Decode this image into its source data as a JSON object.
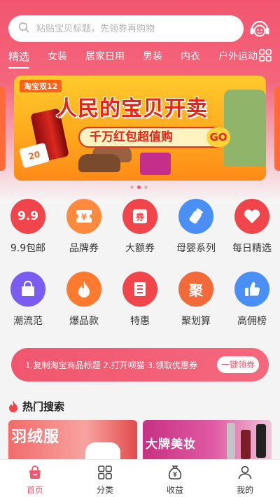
{
  "search": {
    "placeholder": "粘贴宝贝标题，先领券再购物"
  },
  "categories": [
    "精选",
    "女装",
    "居家日用",
    "男装",
    "内衣",
    "户外运动"
  ],
  "banner": {
    "tag": "淘宝双12",
    "headline": "人民的宝贝开卖",
    "subtitle": "千万红包超值购",
    "go": "GO",
    "ticket": "20"
  },
  "icon_rows": [
    [
      {
        "label": "9.9包邮",
        "icon": "nine-nine-icon",
        "glyph": "9.9",
        "color": "#f0454b"
      },
      {
        "label": "品牌券",
        "icon": "ticket-icon",
        "glyph": "¥",
        "color": "#ff8a3d"
      },
      {
        "label": "大额券",
        "icon": "coupon-icon",
        "glyph": "券",
        "color": "#f0454b"
      },
      {
        "label": "母婴系列",
        "icon": "baby-bottle-icon",
        "glyph": "",
        "color": "#4a8ff5"
      },
      {
        "label": "每日精选",
        "icon": "heart-icon",
        "glyph": "",
        "color": "#f0454b"
      }
    ],
    [
      {
        "label": "潮流范",
        "icon": "bag-icon",
        "glyph": "",
        "color": "#7a5cf0"
      },
      {
        "label": "爆品款",
        "icon": "fire-icon",
        "glyph": "",
        "color": "#ff7a2e"
      },
      {
        "label": "特惠",
        "icon": "tag-icon",
        "glyph": "",
        "color": "#f0454b"
      },
      {
        "label": "聚划算",
        "icon": "ju-icon",
        "glyph": "聚",
        "color": "#f26a3a"
      },
      {
        "label": "高佣榜",
        "icon": "thumbs-up-icon",
        "glyph": "",
        "color": "#4a8ff5"
      }
    ]
  ],
  "tip": {
    "text": "1.复制淘宝商品标题 2.打开呗猫 3.领取优惠券",
    "button": "一键领券"
  },
  "hot": {
    "title": "热门搜索",
    "cards": [
      {
        "label": "羽绒服"
      },
      {
        "label": "大牌美妆"
      }
    ]
  },
  "tabbar": [
    {
      "label": "首页",
      "icon": "home-bag-icon",
      "active": true
    },
    {
      "label": "分类",
      "icon": "grid-icon",
      "active": false
    },
    {
      "label": "收益",
      "icon": "money-bag-icon",
      "active": false
    },
    {
      "label": "我的",
      "icon": "user-icon",
      "active": false
    }
  ],
  "colors": {
    "primary": "#f2566f",
    "accent_orange": "#ff8a3d",
    "accent_blue": "#4a8ff5"
  }
}
